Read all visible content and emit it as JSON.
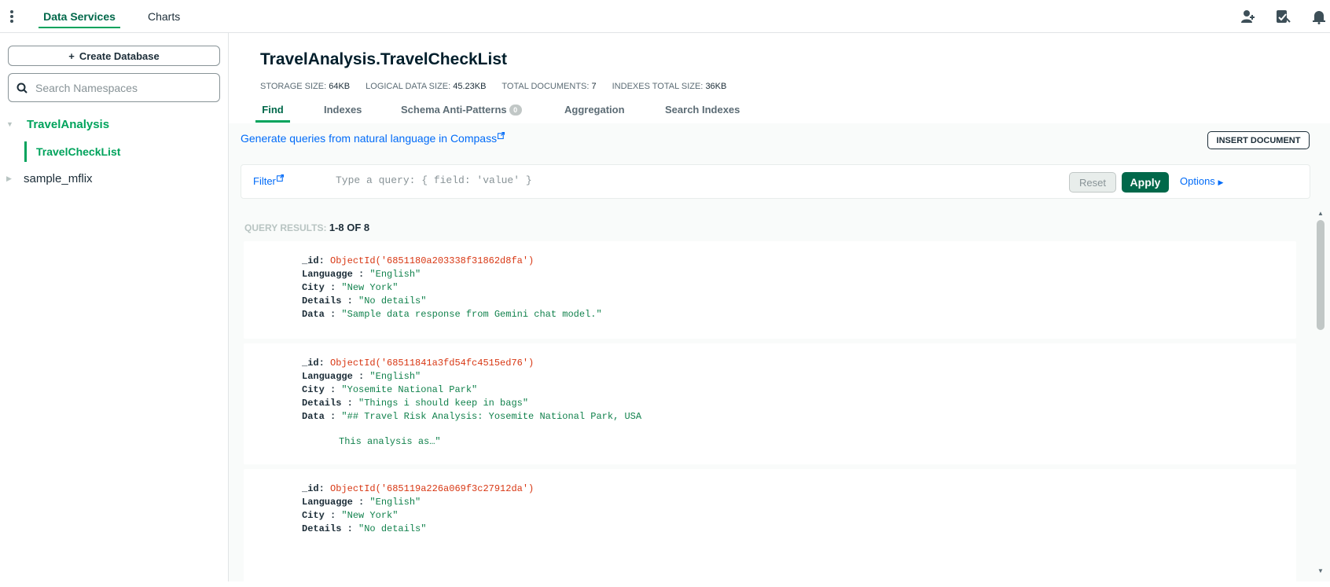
{
  "topbar": {
    "tabs": [
      {
        "label": "Data Services"
      },
      {
        "label": "Charts"
      }
    ],
    "icons": [
      "more-vertical-icon",
      "invite-user-icon",
      "activity-feed-icon",
      "notification-bell-icon"
    ]
  },
  "sidebar": {
    "create_label": "Create Database",
    "search_placeholder": "Search Namespaces",
    "databases": [
      {
        "name": "TravelAnalysis",
        "expanded": true,
        "collections": [
          {
            "name": "TravelCheckList",
            "selected": true
          }
        ]
      },
      {
        "name": "sample_mflix",
        "expanded": false
      }
    ]
  },
  "header": {
    "title": "TravelAnalysis.TravelCheckList",
    "stats": [
      {
        "label": "STORAGE SIZE:",
        "value": "64KB"
      },
      {
        "label": "LOGICAL DATA SIZE:",
        "value": "45.23KB"
      },
      {
        "label": "TOTAL DOCUMENTS:",
        "value": "7"
      },
      {
        "label": "INDEXES TOTAL SIZE:",
        "value": "36KB"
      }
    ],
    "tabs": [
      {
        "label": "Find",
        "active": true
      },
      {
        "label": "Indexes"
      },
      {
        "label": "Schema Anti-Patterns",
        "badge": "0"
      },
      {
        "label": "Aggregation"
      },
      {
        "label": "Search Indexes"
      }
    ]
  },
  "toolbar": {
    "nl_link": "Generate queries from natural language in Compass",
    "insert_label": "INSERT DOCUMENT"
  },
  "filter": {
    "label": "Filter",
    "placeholder": "Type a query: { field: 'value' }",
    "reset_label": "Reset",
    "apply_label": "Apply",
    "options_label": "Options"
  },
  "results": {
    "label": "QUERY RESULTS:",
    "range": "1-8 OF 8",
    "documents": [
      {
        "id_key": "_id:",
        "id_value": "ObjectId('6851180a203338f31862d8fa')",
        "lang_key": "Languagge :",
        "lang": "\"English\"",
        "city_key": "City :",
        "city": "\"New York\"",
        "details_key": "Details :",
        "details": "\"No details\"",
        "data_key": "Data :",
        "data": "\"Sample data response from Gemini chat model.\""
      },
      {
        "id_key": "_id:",
        "id_value": "ObjectId('68511841a3fd54fc4515ed76')",
        "lang_key": "Languagge :",
        "lang": "\"English\"",
        "city_key": "City :",
        "city": "\"Yosemite National Park\"",
        "details_key": "Details :",
        "details": "\"Things i should keep in bags\"",
        "data_key": "Data :",
        "data": "\"## Travel Risk Analysis: Yosemite National Park, USA",
        "data_cont": "This analysis as…\""
      },
      {
        "id_key": "_id:",
        "id_value": "ObjectId('685119a226a069f3c27912da')",
        "lang_key": "Languagge :",
        "lang": "\"English\"",
        "city_key": "City :",
        "city": "\"New York\"",
        "details_key": "Details :",
        "details": "\"No details\""
      }
    ]
  },
  "colors": {
    "accent": "#00a35c",
    "accent_dark": "#00684a",
    "link": "#016bf8",
    "object_id": "#d83713",
    "string": "#12824d"
  }
}
